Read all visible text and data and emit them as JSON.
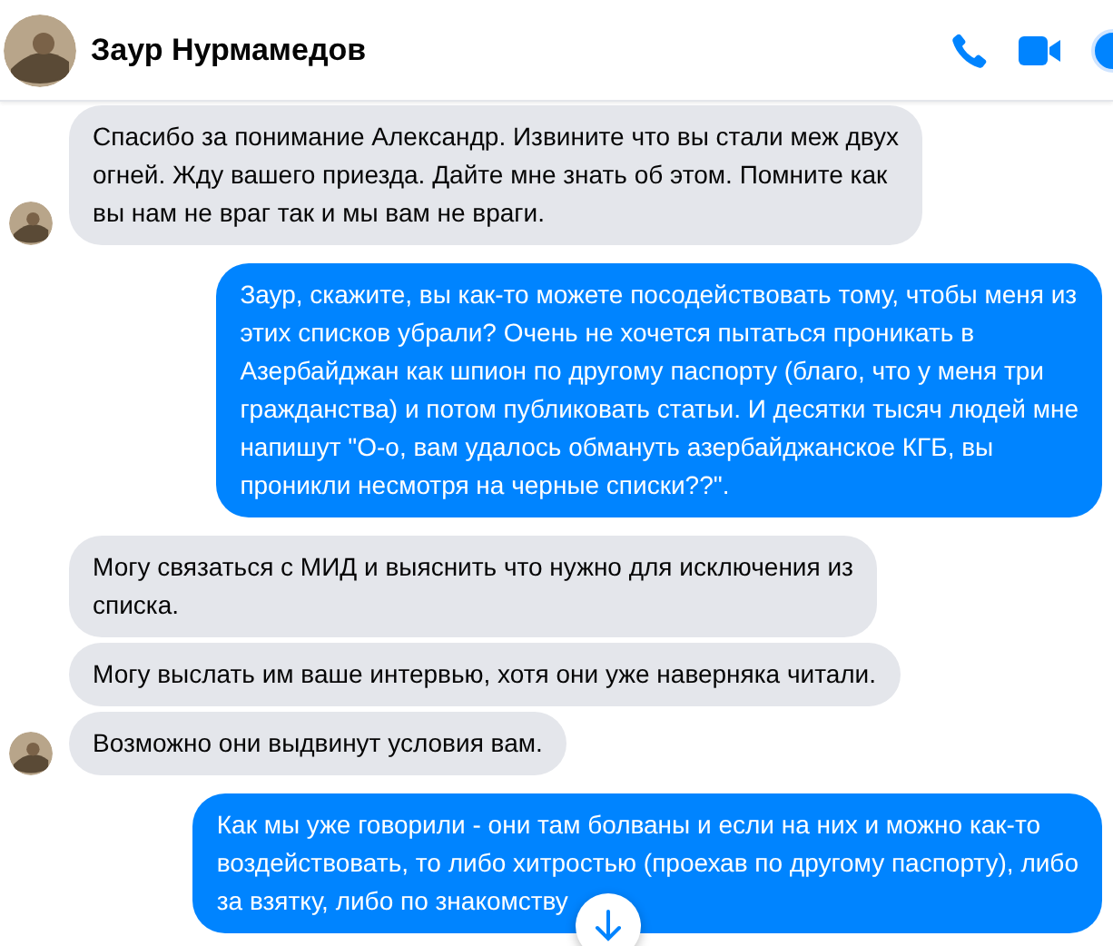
{
  "header": {
    "name": "Заур Нурмамедов"
  },
  "messages": [
    {
      "kind": "incoming",
      "avatar": true,
      "text": "Спасибо за понимание Александр. Извините что вы стали меж двух\nогней. Жду вашего приезда. Дайте мне знать об этом. Помните как\nвы нам не враг так и мы вам не враги."
    },
    {
      "kind": "outgoing",
      "text": "Заур, скажите, вы как-то можете посодействовать тому, чтобы меня из\nэтих списков убрали? Очень не хочется пытаться проникать в\nАзербайджан как шпион по другому паспорту (благо, что у меня три\nгражданства) и потом публиковать статьи. И десятки тысяч людей мне\nнапишут \"О-о, вам удалось обмануть азербайджанское КГБ, вы\nпроникли несмотря на черные списки??\"."
    },
    {
      "kind": "incoming",
      "avatar": false,
      "text": "Могу связаться с МИД и выяснить что нужно для исключения из\nсписка."
    },
    {
      "kind": "incoming",
      "avatar": false,
      "text": "Могу выслать им ваше интервью, хотя они уже наверняка читали."
    },
    {
      "kind": "incoming",
      "avatar": true,
      "text": "Возможно они выдвинут условия вам."
    },
    {
      "kind": "outgoing",
      "text": "Как мы уже говорили - они там болваны и если на них и можно как-то\nвоздействовать, то либо хитростью (проехав по другому паспорту), либо\nза взятку, либо по знакомству"
    }
  ]
}
